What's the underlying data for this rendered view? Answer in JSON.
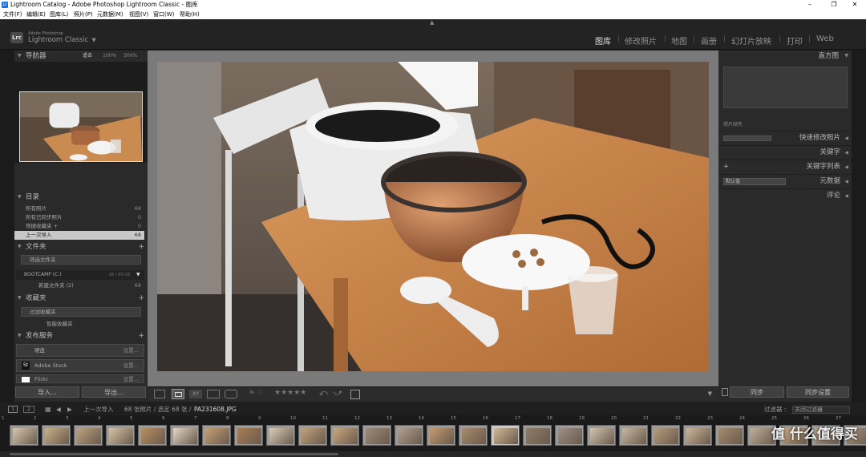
{
  "window": {
    "title": "Lightroom Catalog - Adobe Photoshop Lightroom Classic - 图库",
    "minimize": "–",
    "maximize": "❐",
    "close": "✕",
    "app_icon": "Lr"
  },
  "menu": [
    "文件(F)",
    "编辑(E)",
    "图库(L)",
    "照片(P)",
    "元数据(M)",
    "视图(V)",
    "窗口(W)",
    "帮助(H)"
  ],
  "identity": {
    "logo": "Lrc",
    "line1": "Adobe Photoshop",
    "line2": "Lightroom Classic"
  },
  "modules": [
    "图库",
    "修改照片",
    "地图",
    "画册",
    "幻灯片放映",
    "打印",
    "Web"
  ],
  "navigator": {
    "title": "导航器",
    "zoom_fit": "适合",
    "zoom_100": "100%",
    "zoom_300": "300%"
  },
  "catalog": {
    "title": "目录",
    "rows": [
      {
        "label": "所有照片",
        "count": "68"
      },
      {
        "label": "所有已同步照片",
        "count": "0"
      },
      {
        "label": "快捷收藏夹 +",
        "count": "0"
      },
      {
        "label": "上一次导入",
        "count": "68"
      }
    ]
  },
  "folders": {
    "title": "文件夹",
    "filter": "筛选文件夹",
    "volume": "BOOTCAMP (C:)",
    "volume_info": "88 / 89 GB",
    "subfolder": "新建文件夹 (2)",
    "subfolder_count": "68"
  },
  "collections": {
    "title": "收藏夹",
    "filter": "过滤收藏夹",
    "smart": "智能收藏夹"
  },
  "publish": {
    "title": "发布服务",
    "services": [
      {
        "label": "硬盘",
        "action": "设置..."
      },
      {
        "label": "Adobe Stock",
        "action": "设置..."
      },
      {
        "label": "Flickr",
        "action": "设置..."
      }
    ]
  },
  "left_buttons": {
    "import": "导入...",
    "export": "导出..."
  },
  "right_panels": {
    "histogram": "直方图",
    "missing": "照片缺失",
    "quick_develop": "快速修改照片",
    "keywording": "关键字",
    "keyword_list": "关键字列表",
    "metadata": "元数据",
    "metadata_preset": "默认值",
    "comments": "评论"
  },
  "right_buttons": {
    "sync": "同步",
    "sync_settings": "同步设置"
  },
  "toolbar": {
    "stars": "★★★★★"
  },
  "filmstrip": {
    "page1": "1",
    "page2": "2",
    "source": "上一次导入",
    "summary": "68 张照片 / 选定 68 张 /",
    "filename": "PA231608.JPG",
    "filter_label": "过滤器 :",
    "filter_value": "关闭过滤器",
    "numbers": [
      "1",
      "2",
      "3",
      "4",
      "5",
      "6",
      "7",
      "8",
      "9",
      "10",
      "11",
      "12",
      "13",
      "14",
      "15",
      "16",
      "17",
      "18",
      "19",
      "20",
      "21",
      "22",
      "23",
      "24",
      "25",
      "26",
      "27"
    ]
  },
  "watermark": "值 什么值得买"
}
